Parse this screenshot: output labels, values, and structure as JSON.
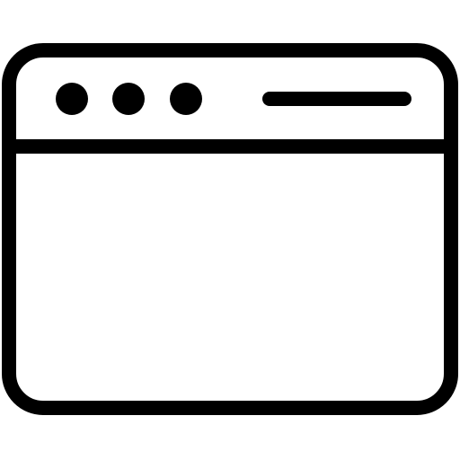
{
  "icon": {
    "name": "browser-window-icon",
    "stroke_color": "#000000",
    "fill_color": "#ffffff",
    "window_controls": [
      "window-dot-1",
      "window-dot-2",
      "window-dot-3"
    ],
    "address_bar": "address-bar-line"
  }
}
